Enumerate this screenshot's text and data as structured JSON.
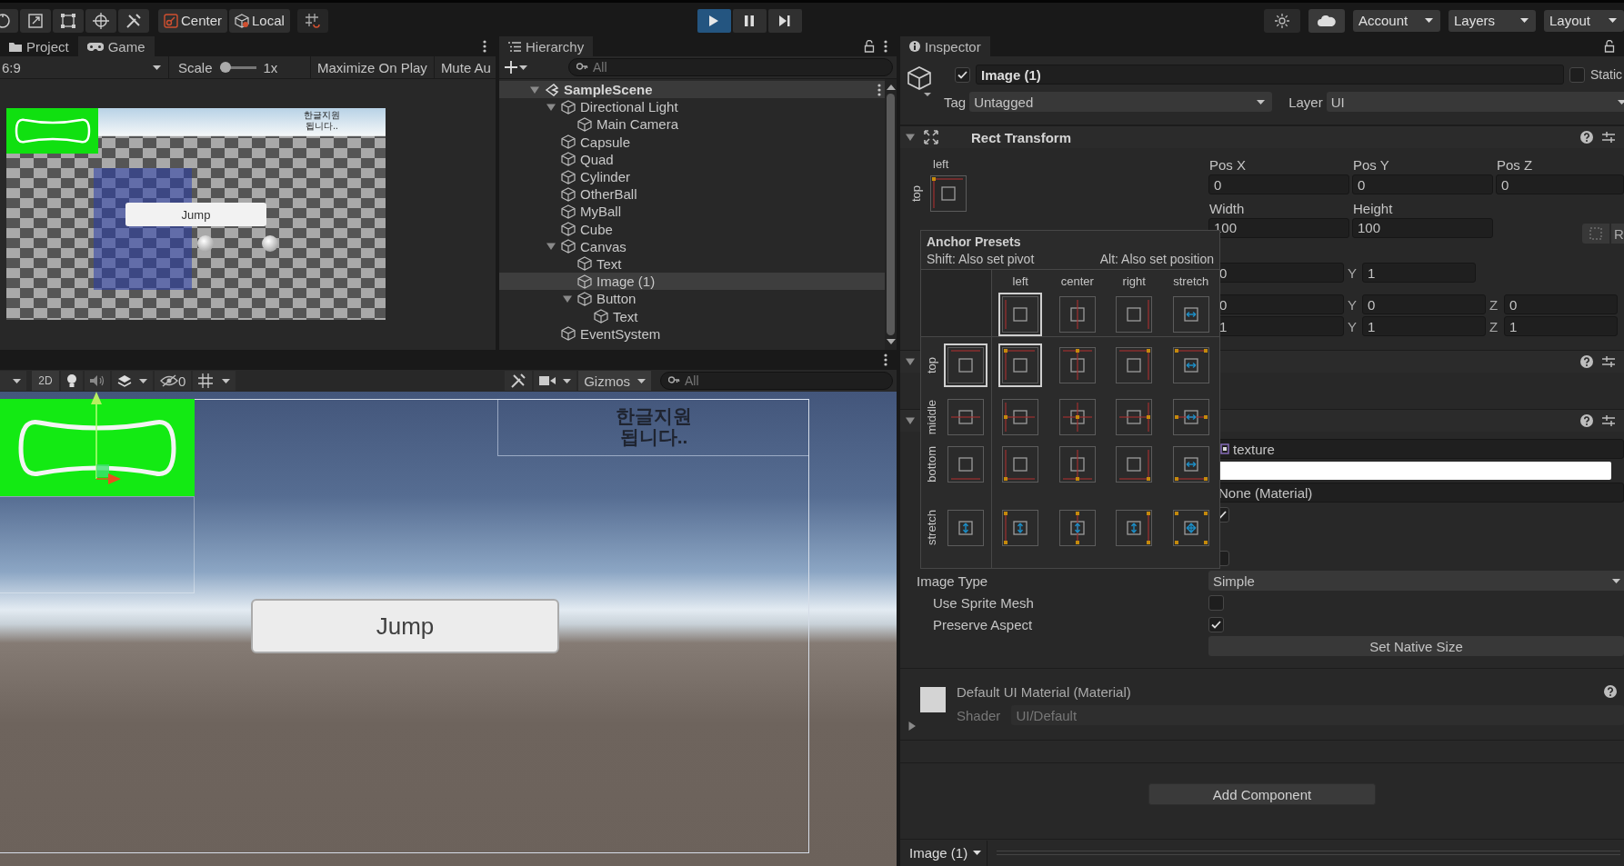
{
  "toolbar": {
    "pivot_mode": "Center",
    "pivot_rotation": "Local",
    "playback": [
      {
        "kind": "play",
        "on": true
      },
      {
        "kind": "pause",
        "on": false
      },
      {
        "kind": "step",
        "on": false
      }
    ],
    "menus": [
      "Account",
      "Layers",
      "Layout"
    ]
  },
  "game_panel": {
    "tabs": [
      {
        "label": "Project",
        "kind": "folder",
        "selected": false
      },
      {
        "label": "Game",
        "kind": "gamepad",
        "selected": true
      }
    ],
    "aspect": "6:9",
    "scale_label": "Scale",
    "scale": {
      "level": 0
    },
    "scale_value": "1x",
    "maximize": "Maximize On Play",
    "mute": "Mute Au",
    "overlay_text": "한글지원\n됩니다..",
    "button": "Jump"
  },
  "hierarchy": {
    "title": "Hierarchy",
    "search": {
      "placeholder": "All"
    },
    "tree": [
      {
        "label": "SampleScene",
        "kind": "scene",
        "selected": false,
        "expanded": true,
        "children": [
          {
            "label": "Directional Light",
            "kind": "object",
            "selected": false,
            "expanded": true,
            "children": [
              {
                "label": "Main Camera",
                "kind": "object",
                "selected": false
              }
            ]
          },
          {
            "label": "Capsule",
            "kind": "object",
            "selected": false
          },
          {
            "label": "Quad",
            "kind": "object",
            "selected": false
          },
          {
            "label": "Cylinder",
            "kind": "object",
            "selected": false
          },
          {
            "label": "OtherBall",
            "kind": "object",
            "selected": false
          },
          {
            "label": "MyBall",
            "kind": "object",
            "selected": false
          },
          {
            "label": "Cube",
            "kind": "object",
            "selected": false
          },
          {
            "label": "Canvas",
            "kind": "object",
            "selected": false,
            "expanded": true,
            "children": [
              {
                "label": "Text",
                "kind": "object",
                "selected": false
              },
              {
                "label": "Image (1)",
                "kind": "object",
                "selected": true
              },
              {
                "label": "Button",
                "kind": "object",
                "selected": false,
                "expanded": true,
                "children": [
                  {
                    "label": "Text",
                    "kind": "object",
                    "selected": false
                  }
                ]
              }
            ]
          },
          {
            "label": "EventSystem",
            "kind": "object",
            "selected": false
          }
        ]
      }
    ]
  },
  "scene_panel": {
    "mode": "2D",
    "hidden_count": "0",
    "gizmos": "Gizmos",
    "search": {
      "placeholder": "All"
    },
    "overlay_text": "한글지원\n됩니다..",
    "button": "Jump"
  },
  "inspector": {
    "title": "Inspector",
    "object": {
      "active": true,
      "name": "Image (1)",
      "static": false,
      "static_label": "Static",
      "tag_label": "Tag",
      "tag": "Untagged",
      "layer_label": "Layer",
      "layer": "UI"
    },
    "rect_transform": {
      "title": "Rect Transform",
      "expanded": true,
      "anchor_x": "left",
      "anchor_y": "top",
      "fields": [
        {
          "label": "Pos X",
          "value": "0"
        },
        {
          "label": "Pos Y",
          "value": "0"
        },
        {
          "label": "Pos Z",
          "value": "0"
        },
        {
          "label": "Width",
          "value": "100"
        },
        {
          "label": "Height",
          "value": "100"
        }
      ],
      "raw_button": "R",
      "vectors": [
        [
          {
            "value": "0"
          },
          {
            "axis": "Y",
            "value": "1"
          }
        ],
        [
          {
            "value": "0"
          },
          {
            "axis": "Y",
            "value": "0"
          },
          {
            "axis": "Z",
            "value": "0"
          }
        ],
        [
          {
            "value": "1"
          },
          {
            "axis": "Y",
            "value": "1"
          },
          {
            "axis": "Z",
            "value": "1"
          }
        ]
      ]
    },
    "component_2": {
      "expanded": true
    },
    "image": {
      "expanded": true,
      "sprite": "texture",
      "material": "None (Material)",
      "toggles": [
        {
          "checked": true
        },
        {
          "checked": false
        }
      ],
      "props": [
        {
          "kind": "dropdown",
          "label": "Image Type",
          "value": "Simple"
        },
        {
          "kind": "checkbox",
          "label": "Use Sprite Mesh",
          "checked": false
        },
        {
          "kind": "checkbox",
          "label": "Preserve Aspect",
          "checked": true
        }
      ],
      "native_button": "Set Native Size"
    },
    "material": {
      "name": "Default UI Material (Material)",
      "shader_label": "Shader",
      "shader": "UI/Default"
    },
    "add_component": "Add Component",
    "footer": "Image (1)"
  },
  "anchor_presets": {
    "title": "Anchor Presets",
    "hint_pivot": "Shift: Also set pivot",
    "hint_position": "Alt: Also set position",
    "columns": [
      {
        "label": "left",
        "selected": true
      },
      {
        "label": "center",
        "selected": false
      },
      {
        "label": "right",
        "selected": false
      },
      {
        "label": "stretch",
        "selected": false
      }
    ],
    "rows": [
      {
        "label": "top",
        "selected": true,
        "cells": [
          {
            "selected": true
          },
          {
            "selected": false
          },
          {
            "selected": false
          },
          {
            "selected": false
          }
        ]
      },
      {
        "label": "middle",
        "selected": false,
        "cells": [
          {
            "selected": false
          },
          {
            "selected": false
          },
          {
            "selected": false
          },
          {
            "selected": false
          }
        ]
      },
      {
        "label": "bottom",
        "selected": false,
        "cells": [
          {
            "selected": false
          },
          {
            "selected": false
          },
          {
            "selected": false
          },
          {
            "selected": false
          }
        ]
      },
      {
        "label": "stretch",
        "selected": false,
        "cells": [
          {
            "selected": false
          },
          {
            "selected": false
          },
          {
            "selected": false
          },
          {
            "selected": false
          }
        ]
      }
    ]
  }
}
